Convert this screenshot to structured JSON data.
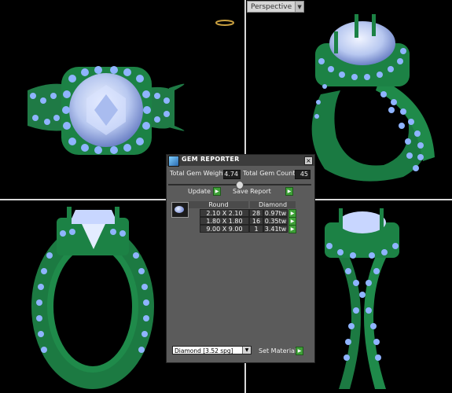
{
  "viewport": {
    "view_mode": "Perspective",
    "colors": {
      "metal": "#1f8a4a",
      "gem": "#8fb4ff",
      "background": "#000000"
    }
  },
  "gem_reporter": {
    "title": "GEM REPORTER",
    "total_weight_label": "Total Gem Weight",
    "total_weight_value": "4.74",
    "total_count_label": "Total Gem Count",
    "total_count_value": "45",
    "update_label": "Update",
    "save_report_label": "Save Report",
    "columns": [
      "Round",
      "Diamond"
    ],
    "rows": [
      {
        "size": "2.10 X 2.10",
        "count": "28",
        "weight": "0.97tw"
      },
      {
        "size": "1.80 X 1.80",
        "count": "16",
        "weight": "0.35tw"
      },
      {
        "size": "9.00 X 9.00",
        "count": "1",
        "weight": "3.41tw"
      }
    ],
    "material_select": "Diamond      [3.52 spg]",
    "set_material_label": "Set Material"
  }
}
